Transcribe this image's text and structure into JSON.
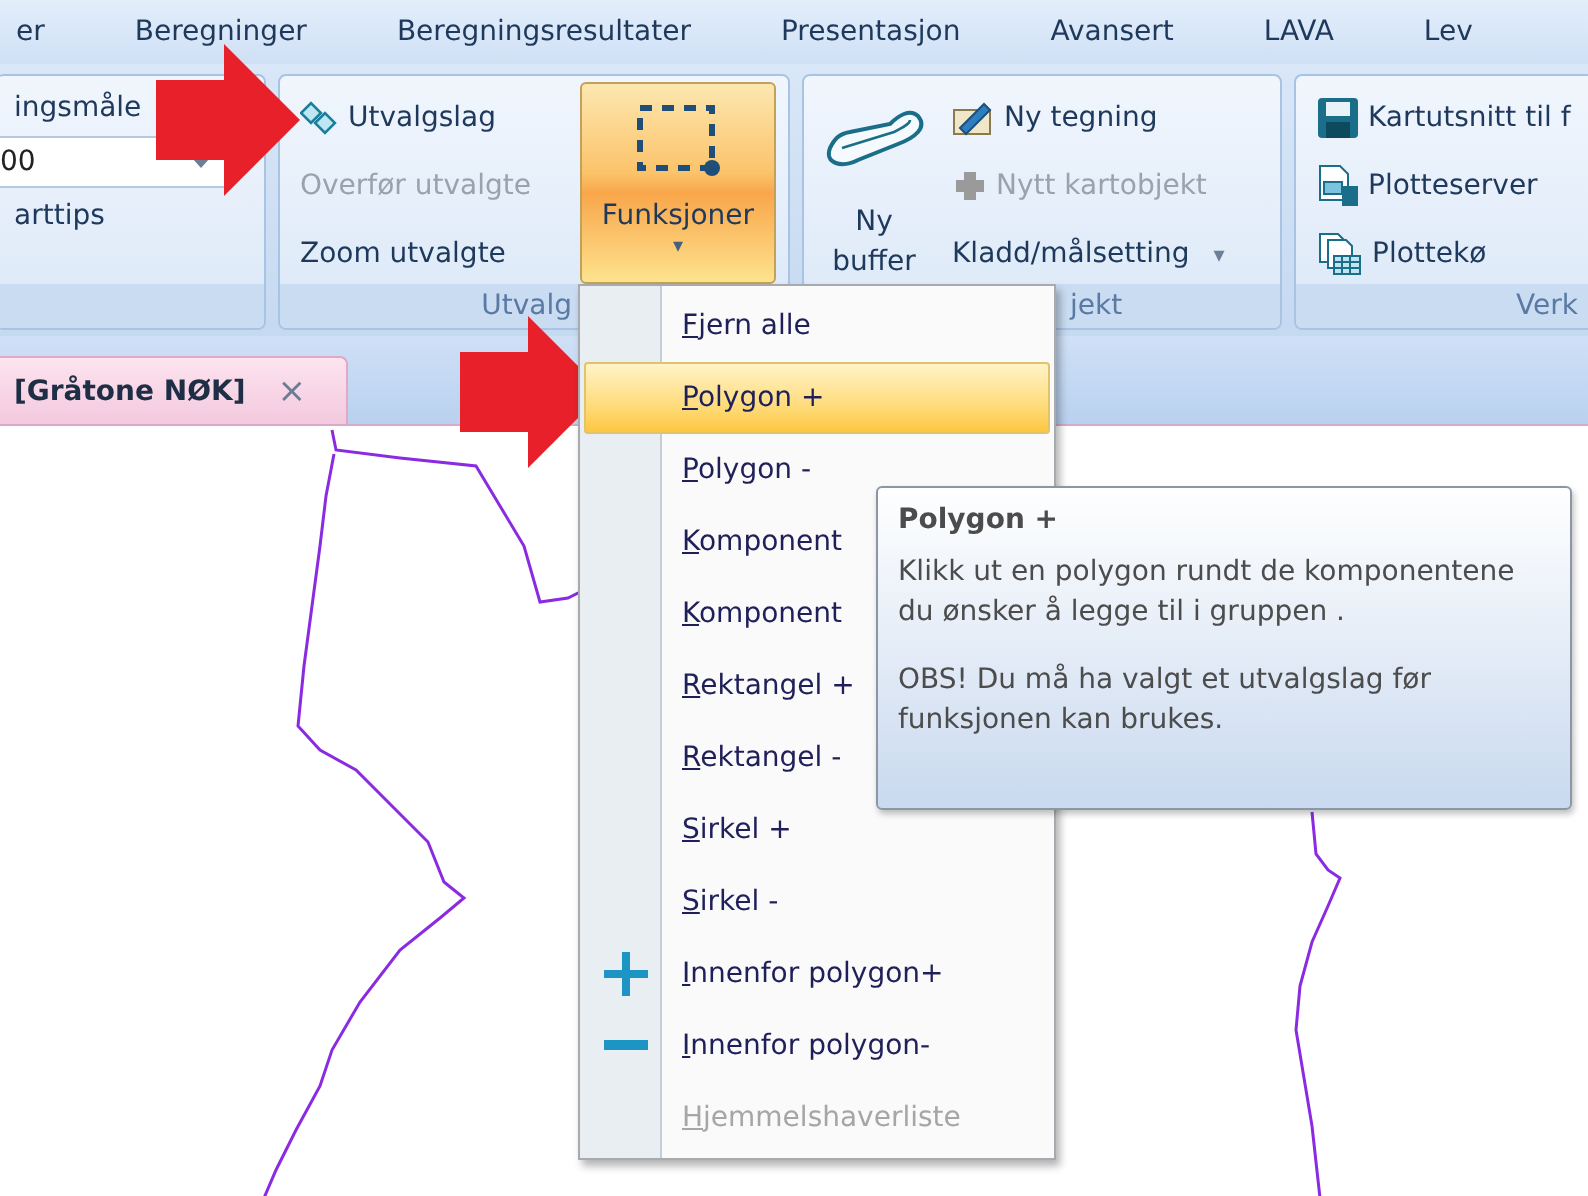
{
  "menu_tabs": [
    "er",
    "Beregninger",
    "Beregningsresultater",
    "Presentasjon",
    "Avansert",
    "LAVA",
    "Lev"
  ],
  "ribbon": {
    "groups": [
      {
        "kind": "left",
        "items": [
          {
            "kind": "label",
            "label": "ingsmåle"
          },
          {
            "kind": "combo",
            "value": "00"
          },
          {
            "kind": "label",
            "label": "arttips"
          }
        ]
      },
      {
        "kind": "selection",
        "label": "Utvalg",
        "items": [
          {
            "kind": "small",
            "label": "Utvalgslag",
            "disabled": false
          },
          {
            "kind": "small",
            "label": "Overfør utvalgte",
            "disabled": true
          },
          {
            "kind": "small",
            "label": "Zoom utvalgte",
            "disabled": false
          },
          {
            "kind": "big",
            "label": "Funksjoner",
            "caret": "▾",
            "selected": true
          }
        ]
      },
      {
        "kind": "object",
        "label": "jekt",
        "items": [
          {
            "kind": "big",
            "label": "Ny buffer",
            "selected": false
          },
          {
            "kind": "small",
            "label": "Ny tegning",
            "disabled": false
          },
          {
            "kind": "small",
            "label": "Nytt kartobjekt",
            "disabled": true
          },
          {
            "kind": "small",
            "label": "Kladd/målsetting",
            "caret": "▾",
            "disabled": false
          }
        ]
      },
      {
        "kind": "tools",
        "label": "Verk",
        "items": [
          {
            "kind": "small",
            "label": "Kartutsnitt til f",
            "disabled": false
          },
          {
            "kind": "small",
            "label": "Plotteserver",
            "disabled": false
          },
          {
            "kind": "small",
            "label": "Plottekø",
            "disabled": false
          }
        ]
      }
    ]
  },
  "document_tab": {
    "label": "[Gråtone NØK]",
    "close": "×"
  },
  "context_menu": {
    "items": [
      {
        "kind": "plain",
        "label": "Fjern alle",
        "selected": false,
        "disabled": false
      },
      {
        "kind": "plain",
        "label": "Polygon +",
        "selected": true,
        "disabled": false
      },
      {
        "kind": "plain",
        "label": "Polygon -",
        "selected": false,
        "disabled": false
      },
      {
        "kind": "plain",
        "label": "Komponent",
        "selected": false,
        "disabled": false
      },
      {
        "kind": "plain",
        "label": "Komponent",
        "selected": false,
        "disabled": false
      },
      {
        "kind": "plain",
        "label": "Rektangel +",
        "selected": false,
        "disabled": false
      },
      {
        "kind": "plain",
        "label": "Rektangel -",
        "selected": false,
        "disabled": false
      },
      {
        "kind": "plain",
        "label": "Sirkel +",
        "selected": false,
        "disabled": false
      },
      {
        "kind": "plain",
        "label": "Sirkel -",
        "selected": false,
        "disabled": false
      },
      {
        "kind": "plus",
        "label": "Innenfor polygon+",
        "selected": false,
        "disabled": false
      },
      {
        "kind": "minus",
        "label": "Innenfor polygon-",
        "selected": false,
        "disabled": false
      },
      {
        "kind": "plain",
        "label": "Hjemmelshaverliste",
        "selected": false,
        "disabled": true
      }
    ]
  },
  "tooltip": {
    "title": "Polygon +",
    "paragraphs": [
      "Klikk ut en polygon rundt de komponentene du ønsker å legge til i gruppen .",
      "OBS! Du må ha valgt et utvalgslag før funksjonen kan brukes."
    ]
  }
}
